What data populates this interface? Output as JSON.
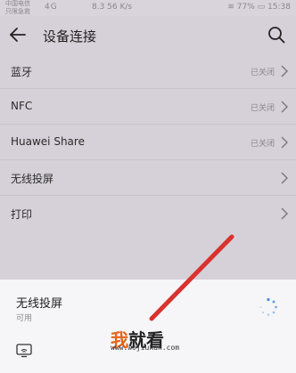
{
  "status_bar": {
    "carrier_line1": "中国电信",
    "carrier_line2": "只限急救",
    "network": "4G",
    "speed": "8.3 56 K/s",
    "battery": "77%",
    "time": "15:38"
  },
  "header": {
    "title": "设备连接",
    "back_icon": "arrow-left-icon",
    "search_icon": "search-icon"
  },
  "list": [
    {
      "label": "蓝牙",
      "value": "已关闭"
    },
    {
      "label": "NFC",
      "value": "已关闭"
    },
    {
      "label": "Huawei Share",
      "value": "已关闭"
    },
    {
      "label": "无线投屏",
      "value": ""
    },
    {
      "label": "打印",
      "value": ""
    }
  ],
  "sheet": {
    "title": "无线投屏",
    "subtitle": "可用",
    "spinner_icon": "loading-spinner-icon",
    "cast_icon": "screen-cast-icon"
  },
  "watermark": {
    "logo_part1": "我",
    "logo_part2": "就看",
    "url": "www.wojiukan.com"
  },
  "colors": {
    "background": "#d6d0d8",
    "sheet": "#f6f5f7",
    "annotation_red": "#d8332f",
    "watermark_orange": "#e2661c"
  }
}
